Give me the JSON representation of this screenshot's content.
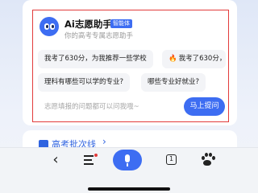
{
  "assistant": {
    "title": "Ai志愿助手",
    "badge": "智能体",
    "subtitle": "你的高考专属志愿助手"
  },
  "suggestions": [
    {
      "label": "我考了630分，为我推荐一些学校"
    },
    {
      "label": "我考了630分，",
      "icon": "fire-icon"
    },
    {
      "label": "理科有哪些可以学的专业?"
    },
    {
      "label": "哪些专业好就业?"
    }
  ],
  "input": {
    "placeholder": "志愿填报的问题都可以问我哦~",
    "submit_label": "马上提问"
  },
  "link": {
    "label": "高考批次线",
    "chevron": "›"
  },
  "toolbar": {
    "back": "‹",
    "tab_count": "1",
    "icons": [
      "back-icon",
      "menu-icon",
      "mic-icon",
      "tabs-icon",
      "baidu-paw-icon"
    ]
  },
  "colors": {
    "accent": "#3d6df2",
    "highlight": "#e23b3b",
    "fire": "#ff6a1a"
  }
}
